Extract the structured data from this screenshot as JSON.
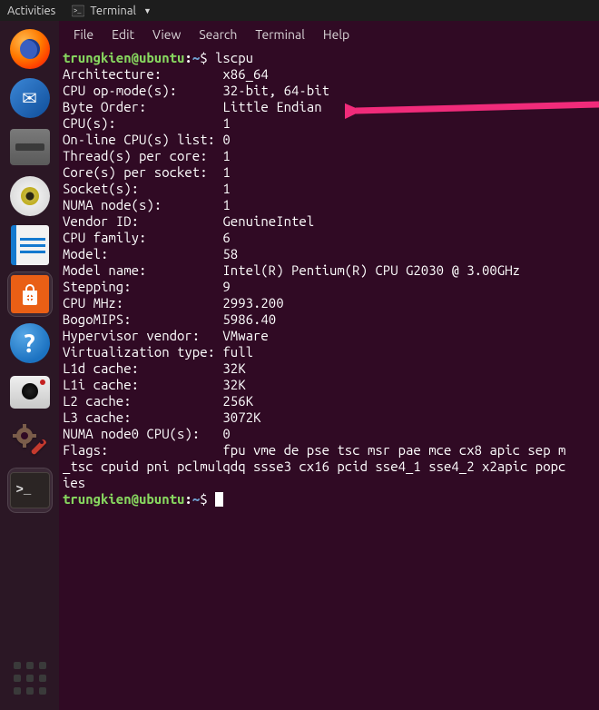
{
  "topbar": {
    "activities": "Activities",
    "app_icon": "terminal-icon",
    "app_label": "Terminal"
  },
  "menubar": [
    "File",
    "Edit",
    "View",
    "Search",
    "Terminal",
    "Help"
  ],
  "prompt": {
    "userhost": "trungkien@ubuntu",
    "path": "~",
    "symbol": "$"
  },
  "command": "lscpu",
  "output_rows": [
    {
      "label": "Architecture:",
      "value": "x86_64"
    },
    {
      "label": "CPU op-mode(s):",
      "value": "32-bit, 64-bit"
    },
    {
      "label": "Byte Order:",
      "value": "Little Endian"
    },
    {
      "label": "CPU(s):",
      "value": "1"
    },
    {
      "label": "On-line CPU(s) list:",
      "value": "0"
    },
    {
      "label": "Thread(s) per core:",
      "value": "1"
    },
    {
      "label": "Core(s) per socket:",
      "value": "1"
    },
    {
      "label": "Socket(s):",
      "value": "1"
    },
    {
      "label": "NUMA node(s):",
      "value": "1"
    },
    {
      "label": "Vendor ID:",
      "value": "GenuineIntel"
    },
    {
      "label": "CPU family:",
      "value": "6"
    },
    {
      "label": "Model:",
      "value": "58"
    },
    {
      "label": "Model name:",
      "value": "Intel(R) Pentium(R) CPU G2030 @ 3.00GHz"
    },
    {
      "label": "Stepping:",
      "value": "9"
    },
    {
      "label": "CPU MHz:",
      "value": "2993.200"
    },
    {
      "label": "BogoMIPS:",
      "value": "5986.40"
    },
    {
      "label": "Hypervisor vendor:",
      "value": "VMware"
    },
    {
      "label": "Virtualization type:",
      "value": "full"
    },
    {
      "label": "L1d cache:",
      "value": "32K"
    },
    {
      "label": "L1i cache:",
      "value": "32K"
    },
    {
      "label": "L2 cache:",
      "value": "256K"
    },
    {
      "label": "L3 cache:",
      "value": "3072K"
    },
    {
      "label": "NUMA node0 CPU(s):",
      "value": "0"
    }
  ],
  "output_wrap": [
    "Flags:               fpu vme de pse tsc msr pae mce cx8 apic sep m",
    "_tsc cpuid pni pclmulqdq ssse3 cx16 pcid sse4_1 sse4_2 x2apic popc",
    "ies"
  ],
  "label_width": 21,
  "annotation": {
    "arrow_color": "#f02b7a",
    "target": "CPU op-mode(s)"
  }
}
